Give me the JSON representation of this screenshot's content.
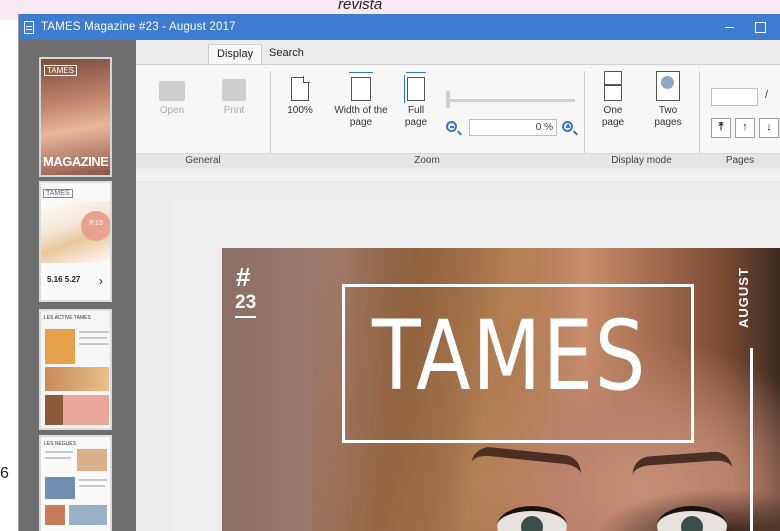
{
  "overlay": {
    "top_word": "revista",
    "left_edge_char": "6"
  },
  "window": {
    "title": "TAMES Magazine #23 - August 2017"
  },
  "ribbon": {
    "tabs": [
      "Display",
      "Search"
    ],
    "active_tab": "Display",
    "general": {
      "label": "General",
      "open": "Open",
      "print": "Print"
    },
    "zoom": {
      "label": "Zoom",
      "btn_100": "100%",
      "width_of_page": "Width of the page",
      "full_page": "Full page",
      "value": "0 %"
    },
    "display_mode": {
      "label": "Display mode",
      "one_page": "One page",
      "two_pages": "Two pages"
    },
    "pages": {
      "label": "Pages",
      "current": "",
      "separator": "/",
      "nav": [
        "⤒",
        "↑",
        "↓",
        "⤓"
      ]
    }
  },
  "thumbnails": {
    "t1": {
      "tag": "TAMES",
      "title": "MAGAZINE"
    },
    "t2": {
      "tag": "TAMES",
      "badge": "P.13",
      "nums": "5.16   5.27",
      "arrow": "›"
    },
    "t3": {
      "header": "LES ACTIVE TAMES"
    },
    "t4": {
      "header": "LES NEGUES"
    }
  },
  "cover": {
    "hash": "#",
    "issue": "23",
    "logo": "TAMES",
    "month": "AUGUST"
  },
  "colors": {
    "titlebar": "#3e7cd2",
    "sidebar": "#6f6f6f",
    "accent": "#3b73c7"
  }
}
